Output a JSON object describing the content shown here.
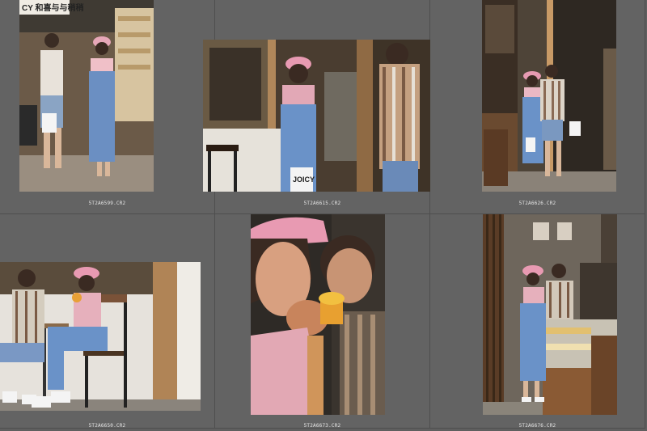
{
  "browser": {
    "thumbnails": [
      {
        "filename": "5T2A6599.CR2",
        "sign_text": "CY 和喜与与稍稍"
      },
      {
        "filename": "5T2A6615.CR2",
        "bag_text": "JOICY"
      },
      {
        "filename": "5T2A6626.CR2"
      },
      {
        "filename": "5T2A6650.CR2"
      },
      {
        "filename": "5T2A6673.CR2"
      },
      {
        "filename": "5T2A6676.CR2"
      }
    ]
  },
  "colors": {
    "background": "#5f5f5f",
    "cell": "#636363",
    "caption_text": "#e6e6e6"
  }
}
